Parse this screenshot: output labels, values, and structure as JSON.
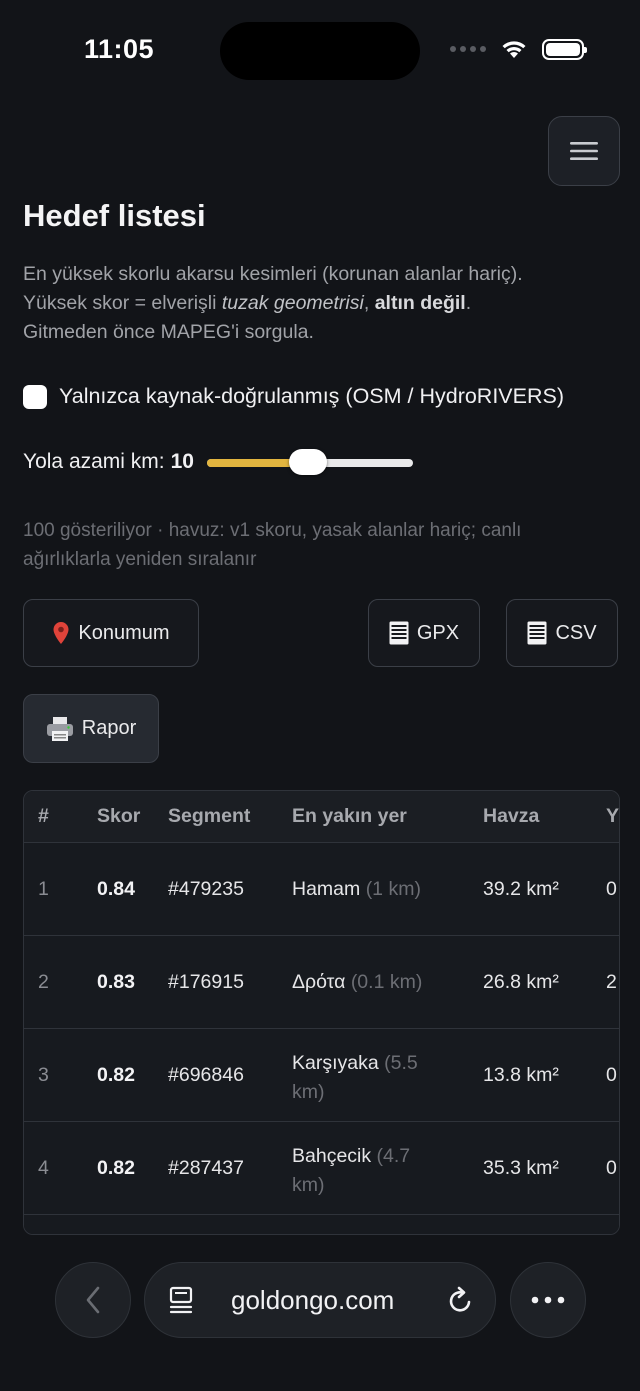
{
  "status_bar": {
    "time": "11:05"
  },
  "page": {
    "title": "Hedef listesi",
    "intro_line1": "En yüksek skorlu akarsu kesimleri (korunan alanlar hariç).",
    "intro_line2_pre": "Yüksek skor = elverişli ",
    "intro_line2_em": "tuzak geometrisi",
    "intro_line2_mid": ", ",
    "intro_line2_strong": "altın değil",
    "intro_line2_post": ".",
    "intro_line3": "Gitmeden önce MAPEG'i sorgula."
  },
  "filters": {
    "verified_only_label": "Yalnızca kaynak-doğrulanmış (OSM / HydroRIVERS)",
    "verified_only_checked": false,
    "max_road_km_label": "Yola azami km:",
    "max_road_km_value": "10",
    "slider_fraction": 0.49
  },
  "summary_text": "100 gösteriliyor · havuz: v1 skoru, yasak alanlar hariç; canlı ağırlıklarla yeniden sıralanır",
  "buttons": {
    "location": "Konumum",
    "gpx": "GPX",
    "csv": "CSV",
    "report": "Rapor"
  },
  "table": {
    "headers": [
      "#",
      "Skor",
      "Segment",
      "En yakın yer",
      "Havza",
      "Y"
    ],
    "rows": [
      {
        "idx": "1",
        "score": "0.84",
        "segment": "#479235",
        "place": "Hamam",
        "dist": "(1 km)",
        "basin": "39.2 km²",
        "extra": "0"
      },
      {
        "idx": "2",
        "score": "0.83",
        "segment": "#176915",
        "place": "Δρότα",
        "dist": "(0.1 km)",
        "basin": "26.8 km²",
        "extra": "2"
      },
      {
        "idx": "3",
        "score": "0.82",
        "segment": "#696846",
        "place": "Karşıyaka",
        "dist": "(5.5",
        "dist2": "km)",
        "basin": "13.8 km²",
        "extra": "0"
      },
      {
        "idx": "4",
        "score": "0.82",
        "segment": "#287437",
        "place": "Bahçecik",
        "dist": "(4.7",
        "dist2": "km)",
        "basin": "35.3 km²",
        "extra": "0"
      }
    ]
  },
  "browser": {
    "url": "goldongo.com"
  },
  "colors": {
    "accent": "#e2b53f",
    "background": "#121418",
    "pin": "#e0433a"
  }
}
